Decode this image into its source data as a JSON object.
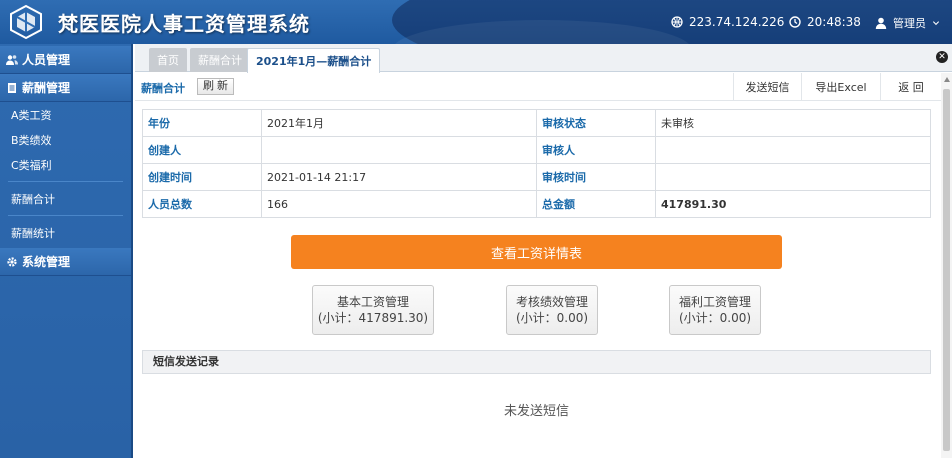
{
  "header": {
    "title": "梵医医院人事工资管理系统",
    "ip": "223.74.124.226",
    "time": "20:48:38",
    "user": "管理员"
  },
  "sidebar": {
    "groups": [
      {
        "label": "人员管理",
        "icon": "users-icon"
      },
      {
        "label": "薪酬管理",
        "icon": "document-icon"
      },
      {
        "label": "系统管理",
        "icon": "gear-icon"
      }
    ],
    "items": [
      "A类工资",
      "B类绩效",
      "C类福利",
      "薪酬合计",
      "薪酬统计"
    ]
  },
  "tabs": [
    "首页",
    "薪酬合计",
    "2021年1月—薪酬合计"
  ],
  "toolbar": {
    "title": "薪酬合计",
    "refresh": "刷 新",
    "send_sms": "发送短信",
    "export": "导出Excel",
    "back": "返 回"
  },
  "info": {
    "year_label": "年份",
    "year_value": "2021年1月",
    "audit_status_label": "审核状态",
    "audit_status_value": "未审核",
    "creator_label": "创建人",
    "creator_value": "",
    "auditor_label": "审核人",
    "auditor_value": "",
    "created_time_label": "创建时间",
    "created_time_value": "2021-01-14 21:17",
    "audit_time_label": "审核时间",
    "audit_time_value": "",
    "headcount_label": "人员总数",
    "headcount_value": "166",
    "total_label": "总金额",
    "total_value": "417891.30"
  },
  "actions": {
    "view_detail": "查看工资详情表",
    "basic_title": "基本工资管理",
    "basic_sub": "(小计：417891.30)",
    "perf_title": "考核绩效管理",
    "perf_sub": "(小计：0.00)",
    "welfare_title": "福利工资管理",
    "welfare_sub": "(小计：0.00)"
  },
  "sms": {
    "heading": "短信发送记录",
    "empty": "未发送短信"
  },
  "colors": {
    "header_blue": "#2f6db3",
    "accent_orange": "#f5821f",
    "label_blue": "#1b6aaa"
  }
}
